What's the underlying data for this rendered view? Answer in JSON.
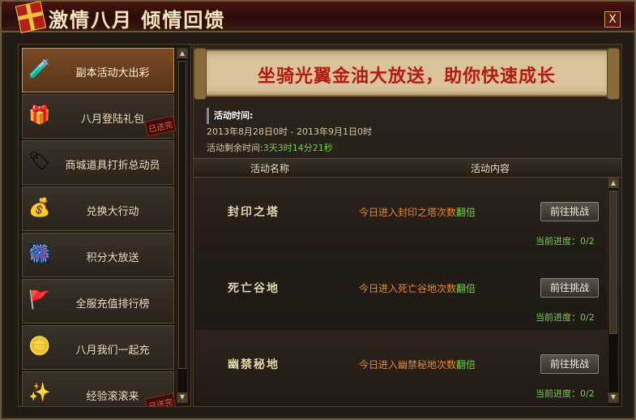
{
  "window": {
    "title": "激情八月  倾情回馈",
    "close_label": "X"
  },
  "sidebar": {
    "items": [
      {
        "label": "副本活动大出彩",
        "icon": "green-bottle-icon",
        "active": true
      },
      {
        "label": "八月登陆礼包",
        "icon": "gift-bag-icon",
        "stamp": "已送完"
      },
      {
        "label": "商城道具打折总动员",
        "icon": "discount-tag-icon"
      },
      {
        "label": "兑换大行动",
        "icon": "gold-ingot-icon"
      },
      {
        "label": "积分大放送",
        "icon": "fireworks-icon"
      },
      {
        "label": "全服充值排行榜",
        "icon": "red-banner-icon"
      },
      {
        "label": "八月我们一起充",
        "icon": "coin-pile-icon"
      },
      {
        "label": "经验滚滚来",
        "icon": "exp-orb-icon",
        "stamp": "已送完"
      }
    ]
  },
  "banner": {
    "text": "坐骑光翼金油大放送，助你快速成长"
  },
  "activity": {
    "time_label": "活动时间:",
    "time_range": "2013年8月28日0时 - 2013年9月1日0时",
    "remaining_label": "活动剩余时间:",
    "remaining_value": "3天3时14分21秒"
  },
  "table": {
    "headers": {
      "name": "活动名称",
      "content": "活动内容"
    },
    "rows": [
      {
        "name": "封印之塔",
        "desc_prefix": "今日进入封印之塔次数",
        "desc_highlight": "翻倍",
        "button": "前往挑战",
        "progress": "当前进度：0/2"
      },
      {
        "name": "死亡谷地",
        "desc_prefix": "今日进入死亡谷地次数",
        "desc_highlight": "翻倍",
        "button": "前往挑战",
        "progress": "当前进度：0/2"
      },
      {
        "name": "幽禁秘地",
        "desc_prefix": "今日进入幽禁秘地次数",
        "desc_highlight": "翻倍",
        "button": "前往挑战",
        "progress": "当前进度：0/2"
      }
    ]
  }
}
